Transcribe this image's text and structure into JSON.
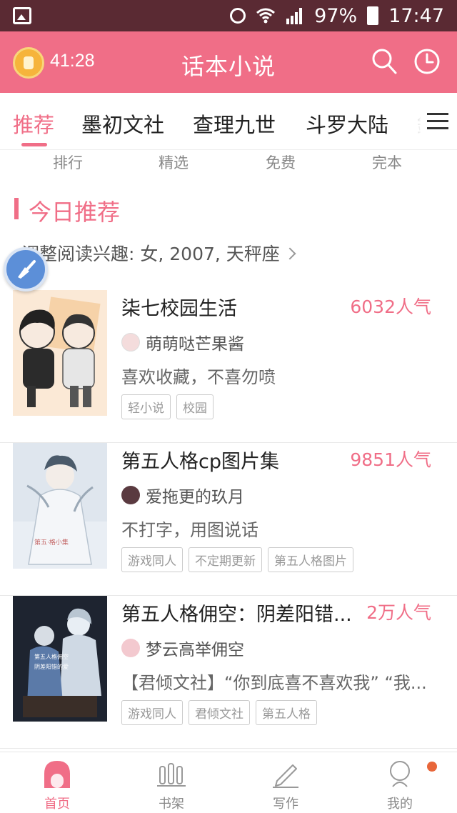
{
  "status_bar": {
    "battery": "97%",
    "time": "17:47"
  },
  "header": {
    "timer": "41:28",
    "title": "话本小说"
  },
  "tabs": [
    {
      "label": "推荐",
      "active": true
    },
    {
      "label": "墨初文社",
      "active": false
    },
    {
      "label": "查理九世",
      "active": false
    },
    {
      "label": "斗罗大陆",
      "active": false
    },
    {
      "label": "鎢",
      "active": false
    }
  ],
  "subnav": [
    "排行",
    "精选",
    "免费",
    "完本"
  ],
  "section": {
    "title": "今日推荐",
    "interest": "调整阅读兴趣: 女, 2007, 天秤座"
  },
  "books": [
    {
      "title": "柒七校园生活",
      "popularity": "6032人气",
      "author": "萌萌哒芒果酱",
      "description": "喜欢收藏，不喜勿喷",
      "tags": [
        "轻小说",
        "校园"
      ]
    },
    {
      "title": "第五人格cp图片集",
      "popularity": "9851人气",
      "author": "爱拖更的玖月",
      "description": "不打字，用图说话",
      "tags": [
        "游戏同人",
        "不定期更新",
        "第五人格图片"
      ]
    },
    {
      "title": "第五人格佣空：阴差阳错...",
      "popularity": "2万人气",
      "author": "梦云高举佣空",
      "description": "【君倾文社】“你到底喜不喜欢我” “我...",
      "tags": [
        "游戏同人",
        "君倾文社",
        "第五人格"
      ]
    }
  ],
  "bottom_nav": [
    {
      "label": "首页",
      "active": true
    },
    {
      "label": "书架",
      "active": false
    },
    {
      "label": "写作",
      "active": false
    },
    {
      "label": "我的",
      "active": false
    }
  ],
  "colors": {
    "accent": "#f06e87",
    "status_bar": "#5a2a33",
    "notification": "#e8663a"
  }
}
